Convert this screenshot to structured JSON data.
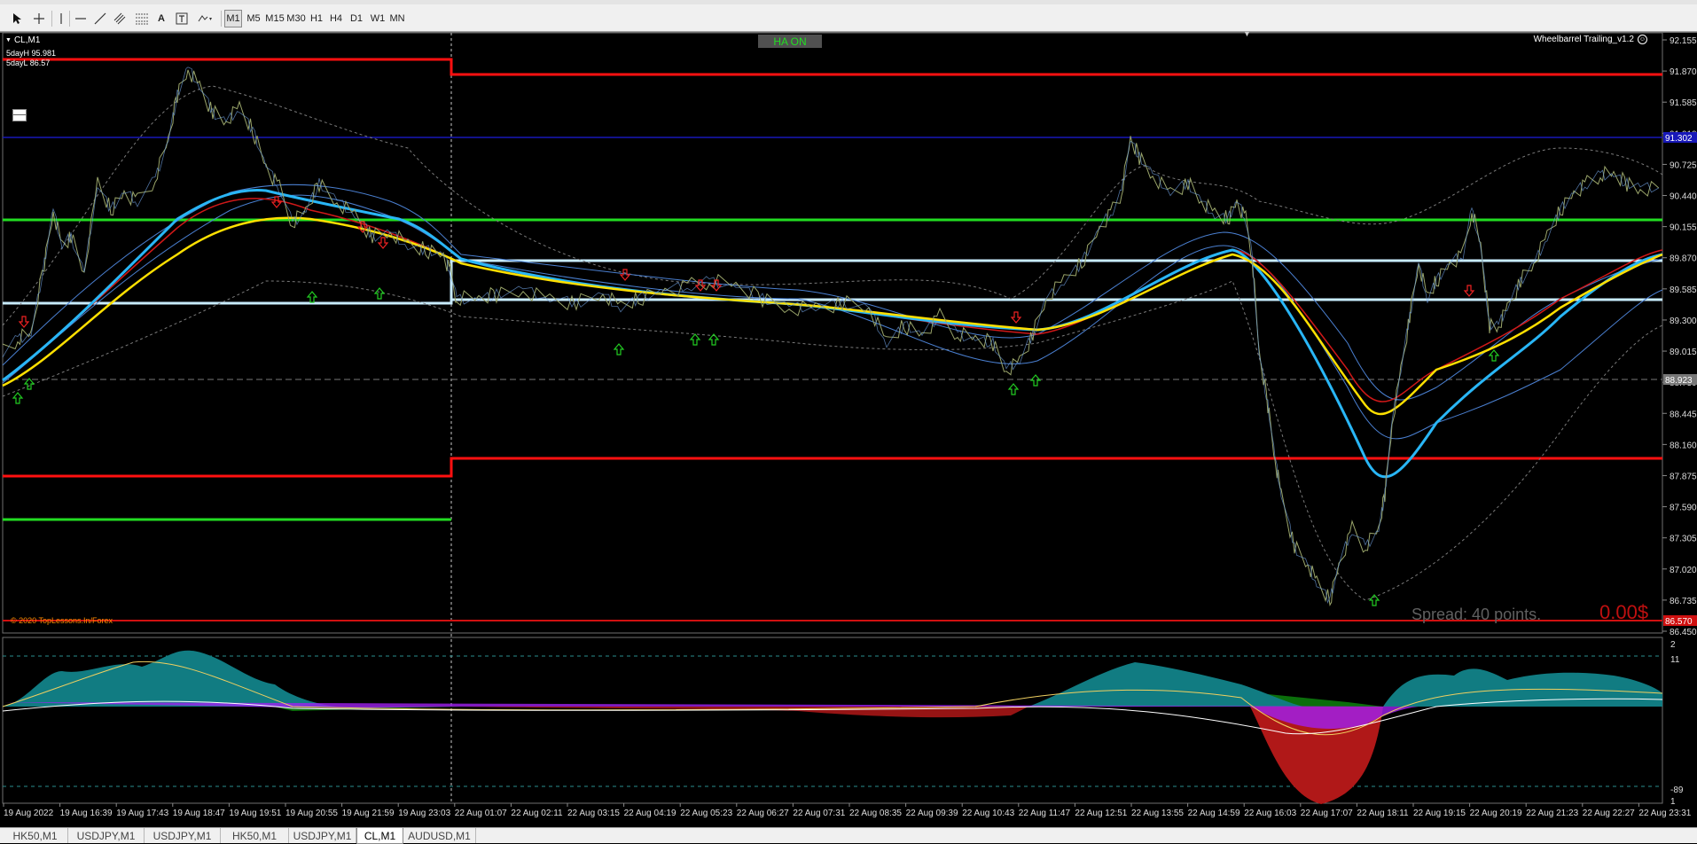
{
  "toolbar": {
    "tools": [
      "cursor-icon",
      "crosshair-icon",
      "vertical-line-icon",
      "horizontal-line-icon",
      "trendline-icon",
      "channels-icon",
      "fibonacci-icon",
      "text-icon",
      "text-label-icon",
      "shapes-icon"
    ],
    "text_tool_label": "A",
    "timeframes": [
      "M1",
      "M5",
      "M15",
      "M30",
      "H1",
      "H4",
      "D1",
      "W1",
      "MN"
    ],
    "active_timeframe": "M1"
  },
  "chart": {
    "symbol_label": "CL,M1",
    "ha_badge": "HA ON",
    "ea_label": "Wheelbarrel Trailing_v1.2",
    "five_day_high": "5dayH 95.981",
    "five_day_low": "5dayL 86.57",
    "copyright": "© 2020 TopLessons.In/Forex",
    "spread": "Spread: 40 points.",
    "profit": "0.00$",
    "price_axis": [
      "92.155",
      "91.870",
      "91.585",
      "91.010",
      "90.725",
      "90.440",
      "90.155",
      "89.870",
      "89.585",
      "89.300",
      "89.015",
      "88.730",
      "88.445",
      "88.160",
      "87.875",
      "87.590",
      "87.305",
      "87.020",
      "86.735",
      "86.450"
    ],
    "price_range": [
      86.45,
      92.155
    ],
    "highlighted_prices": {
      "blue_line": "91.302",
      "dashed_line": "88.923",
      "bottom_line": "86.570"
    },
    "time_axis": [
      "19 Aug 2022",
      "19 Aug 16:39",
      "19 Aug 17:43",
      "19 Aug 18:47",
      "19 Aug 19:51",
      "19 Aug 20:55",
      "19 Aug 21:59",
      "19 Aug 23:03",
      "22 Aug 01:07",
      "22 Aug 02:11",
      "22 Aug 03:15",
      "22 Aug 04:19",
      "22 Aug 05:23",
      "22 Aug 06:27",
      "22 Aug 07:31",
      "22 Aug 08:35",
      "22 Aug 09:39",
      "22 Aug 10:43",
      "22 Aug 11:47",
      "22 Aug 12:51",
      "22 Aug 13:55",
      "22 Aug 14:59",
      "22 Aug 16:03",
      "22 Aug 17:07",
      "22 Aug 18:11",
      "22 Aug 19:15",
      "22 Aug 20:19",
      "22 Aug 21:23",
      "22 Aug 22:27",
      "22 Aug 23:31"
    ],
    "indicator_axis": [
      "2",
      "11",
      "-89",
      "1"
    ],
    "colors": {
      "background": "#000000",
      "price": "#9aa56a",
      "red_level": "#ff1010",
      "green_level": "#22dd22",
      "white_level": "#c8ecff",
      "blue_ma": "#29b6f6",
      "yellow_ma": "#ffe000",
      "histo_up": "#117c82",
      "histo_down": "#b01818",
      "purple": "#a020f0",
      "dark_green": "#0b6e0b"
    }
  },
  "tabs": {
    "items": [
      "HK50,M1",
      "USDJPY,M1",
      "USDJPY,M1",
      "HK50,M1",
      "USDJPY,M1",
      "CL,M1",
      "AUDUSD,M1"
    ],
    "active_index": 5
  }
}
